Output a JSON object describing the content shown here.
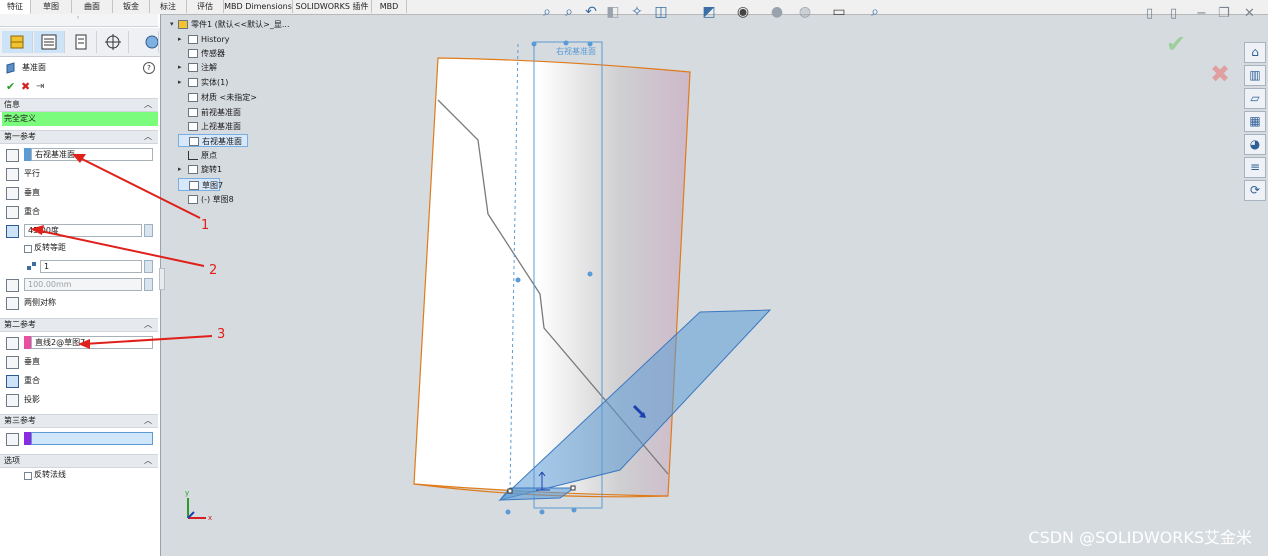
{
  "tabs": [
    "特征",
    "草图",
    "曲面",
    "钣金",
    "标注",
    "评估",
    "MBD Dimensions",
    "SOLIDWORKS 插件",
    "MBD"
  ],
  "panel": {
    "title": "基准面",
    "help_icon": "?",
    "confirm_icons": [
      "✔",
      "✖",
      "⇥"
    ],
    "info": {
      "header": "信息",
      "status": "完全定义"
    },
    "first_ref": {
      "header": "第一参考",
      "selection": "右视基准面",
      "options": [
        "平行",
        "垂直",
        "重合"
      ],
      "angle_value": "45.00度",
      "flip_label": "反转等距",
      "count_value": "1",
      "distance_value": "100.00mm",
      "symmetric_label": "两侧对称"
    },
    "second_ref": {
      "header": "第二参考",
      "selection": "直线2@草图7",
      "options": [
        "垂直",
        "重合",
        "投影"
      ]
    },
    "third_ref": {
      "header": "第三参考"
    },
    "options_section": {
      "header": "选项",
      "flip_normal": "反转法线"
    }
  },
  "tree": {
    "root": "零件1 (默认<<默认>_显...",
    "items": [
      "History",
      "传感器",
      "注解",
      "实体(1)",
      "材质 <未指定>",
      "前视基准面",
      "上视基准面",
      "右视基准面",
      "原点",
      "旋转1",
      "草图7",
      "(-) 草图8"
    ]
  },
  "annotations": [
    "1",
    "2",
    "3"
  ],
  "viewport": {
    "plane_label": "右视基准面",
    "triad_labels": [
      "y",
      "x"
    ]
  },
  "watermark": "CSDN @SOLIDWORKS艾金米",
  "colors": {
    "selection_blue": "#5b9bd5",
    "selection_pink": "#e84fa0",
    "selection_purple": "#8a2be2",
    "status_green": "#7cfc7c",
    "arrow_red": "#e0201b",
    "edge_orange": "#e07b1a"
  }
}
